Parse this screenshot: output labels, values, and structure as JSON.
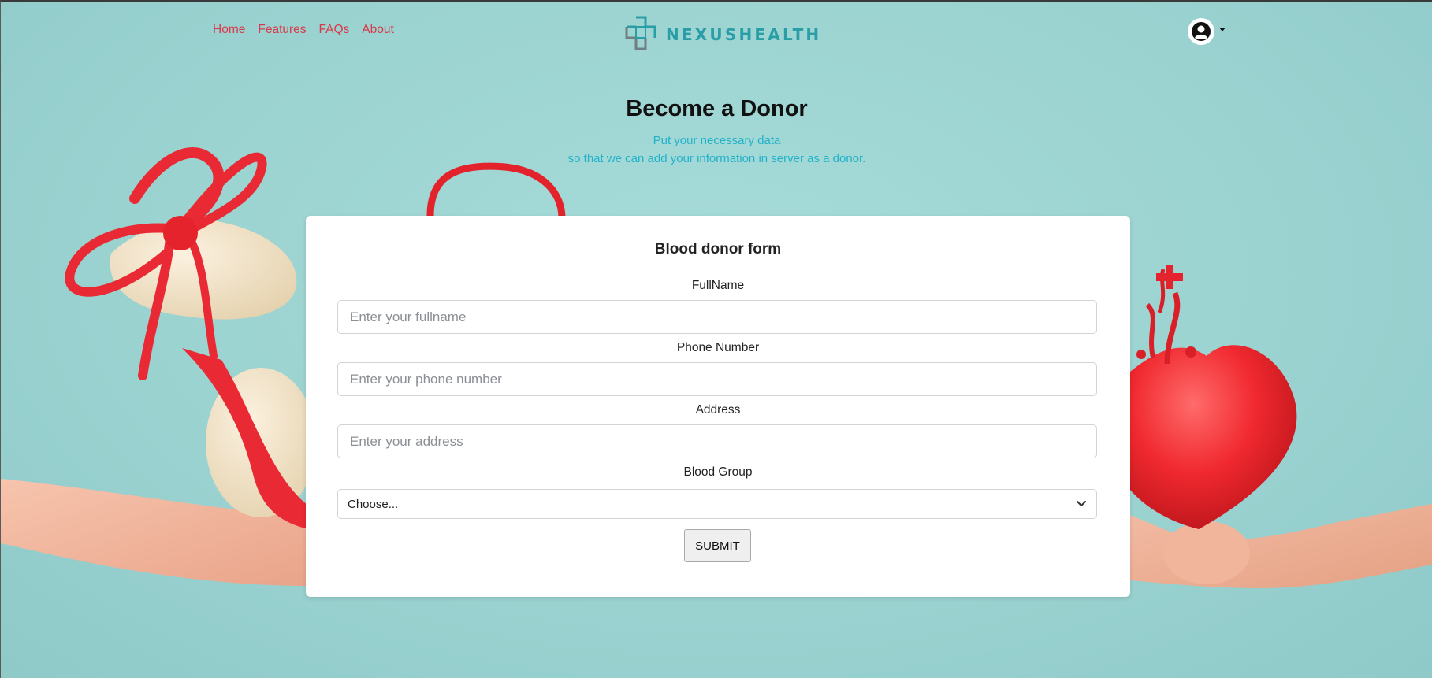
{
  "nav": {
    "links": [
      {
        "label": "Home"
      },
      {
        "label": "Features"
      },
      {
        "label": "FAQs"
      },
      {
        "label": "About"
      }
    ],
    "brand": "NEXUSHEALTH"
  },
  "hero": {
    "title": "Become a Donor",
    "subtitle_line1": "Put your necessary data",
    "subtitle_line2": "so that we can add your information in server as a donor."
  },
  "form": {
    "title": "Blood donor form",
    "fullname": {
      "label": "FullName",
      "placeholder": "Enter your fullname",
      "value": ""
    },
    "phone": {
      "label": "Phone Number",
      "placeholder": "Enter your phone number",
      "value": ""
    },
    "address": {
      "label": "Address",
      "placeholder": "Enter your address",
      "value": ""
    },
    "blood_group": {
      "label": "Blood Group",
      "selected": "Choose..."
    },
    "submit_label": "SUBMIT"
  },
  "colors": {
    "nav_link": "#d9394a",
    "brand": "#2a9ea6",
    "subtitle": "#21b2c9",
    "background": "#9fd6d4"
  },
  "icons": {
    "brand_logo": "medical-cross-icon",
    "account": "user-circle-icon",
    "account_caret": "caret-down-icon",
    "select_chevron": "chevron-down-icon"
  }
}
